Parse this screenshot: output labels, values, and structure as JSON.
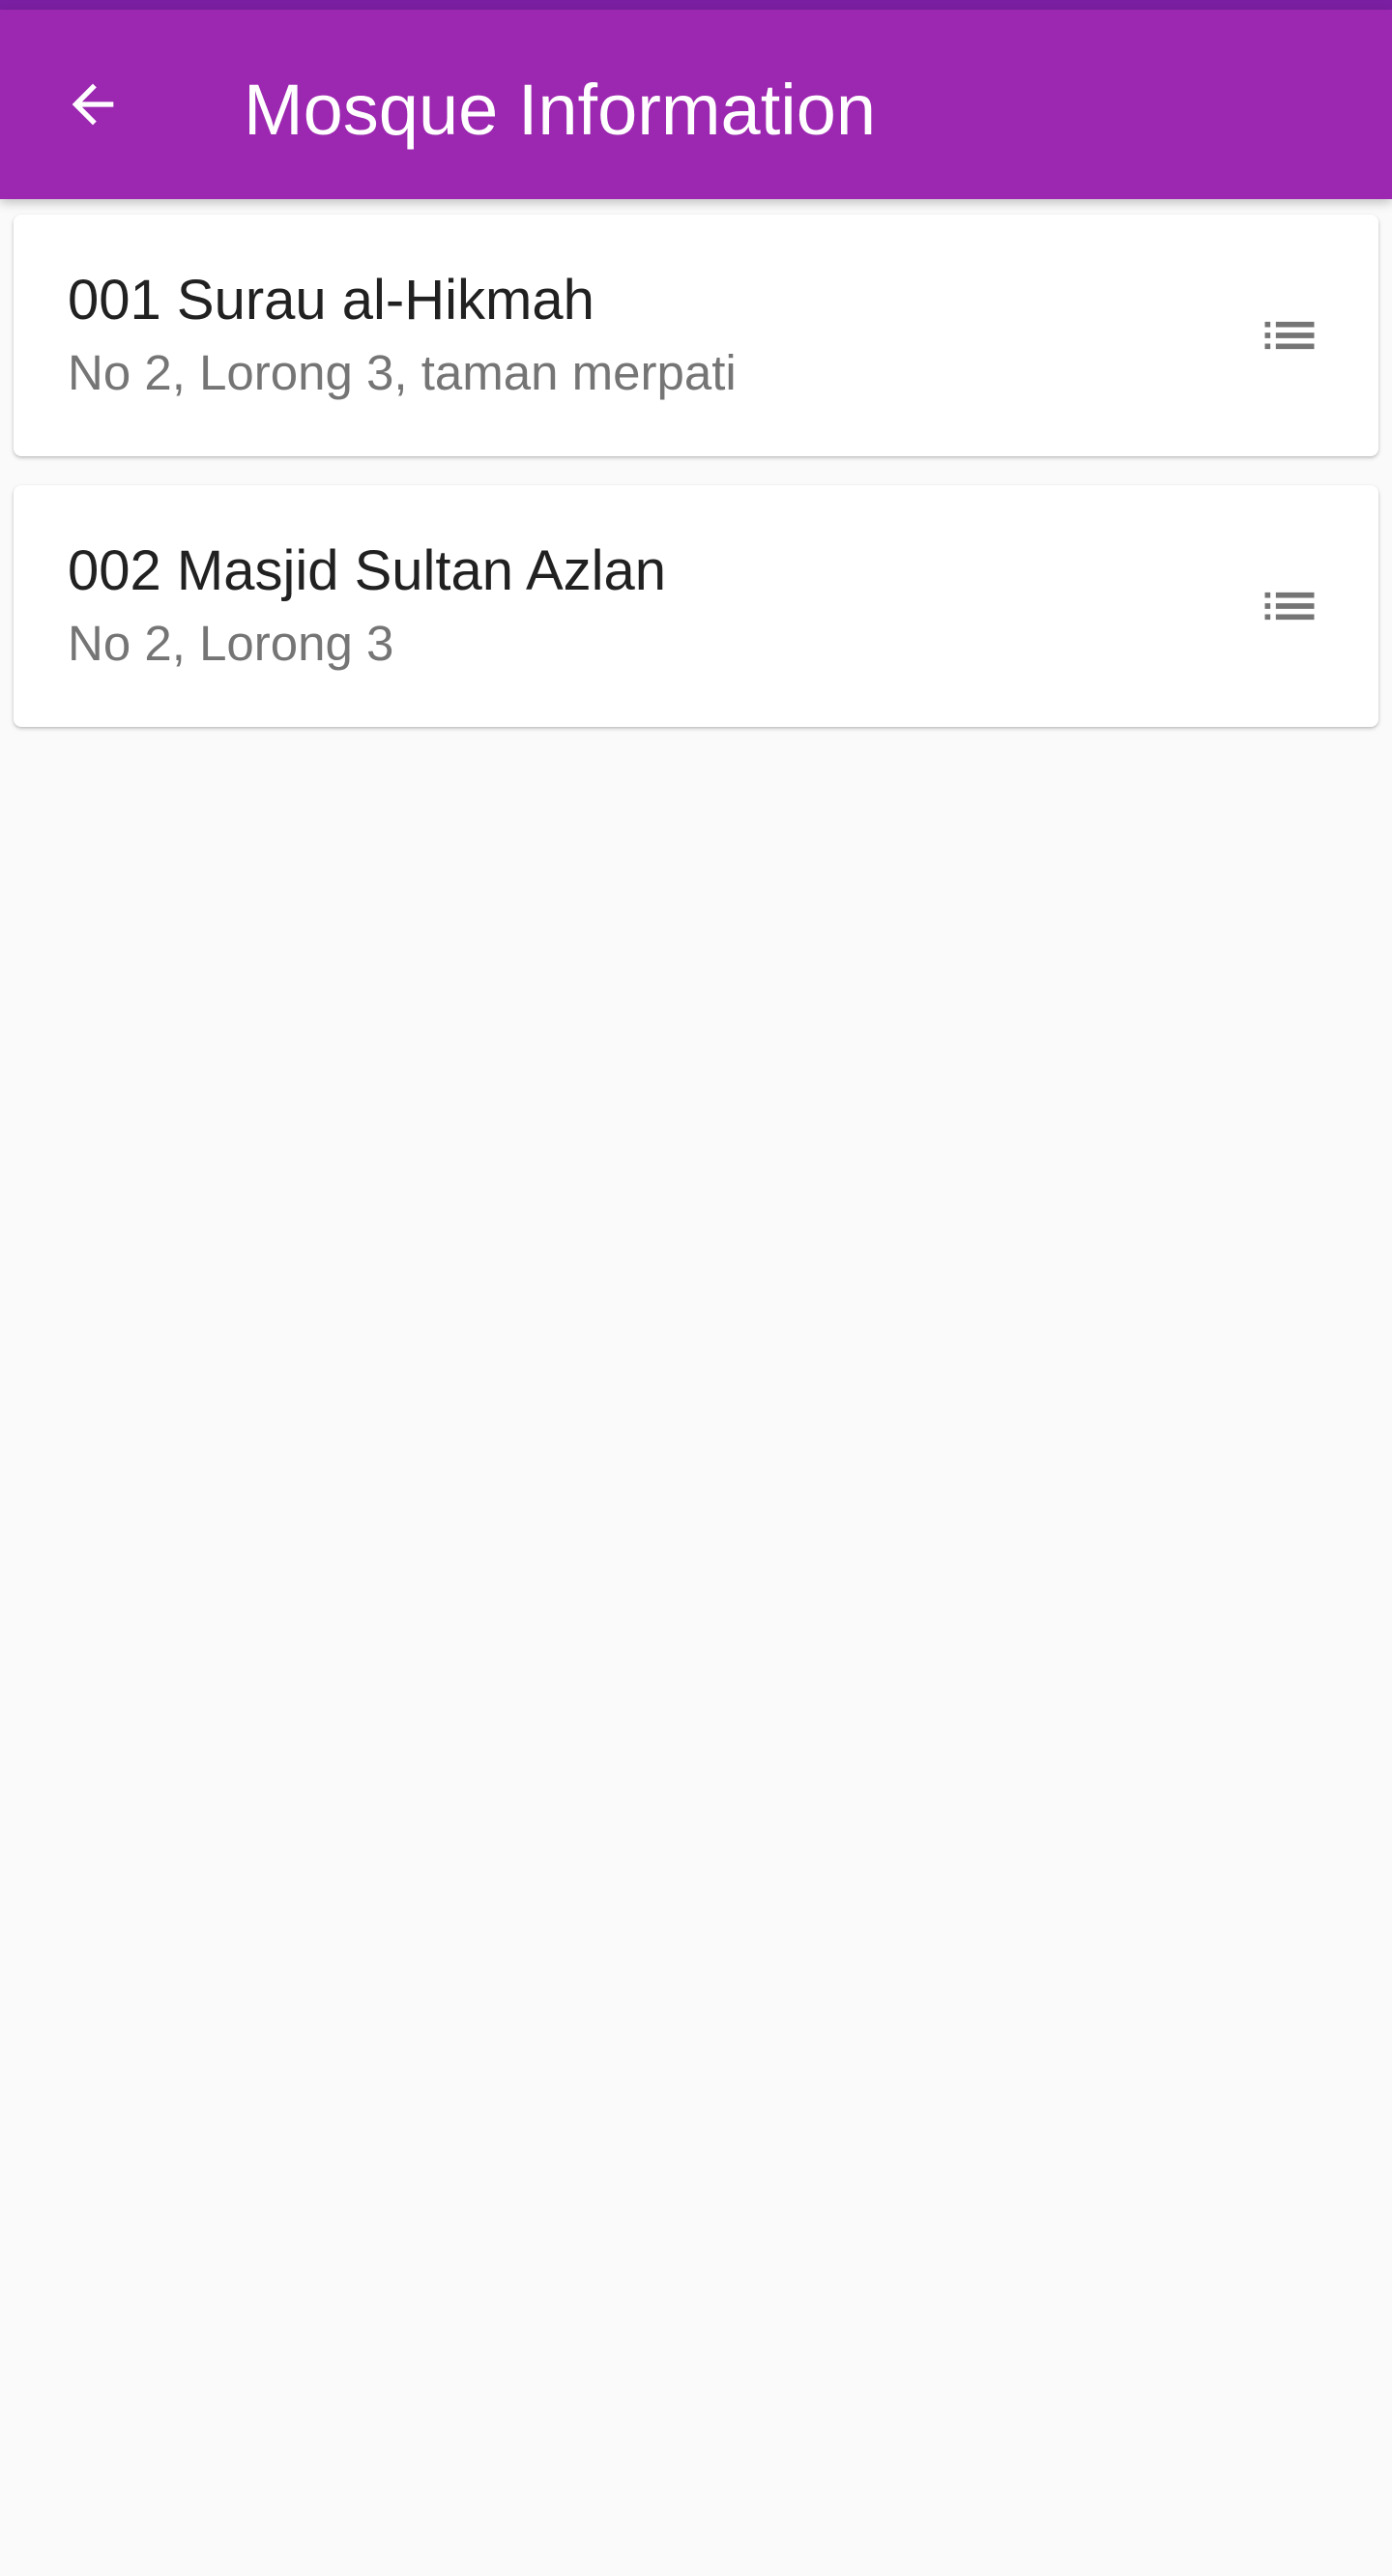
{
  "app_bar": {
    "title": "Mosque Information",
    "back_icon": "arrow-back-icon",
    "color": "#9c27b0",
    "status_color": "#7b1fa2"
  },
  "mosques": [
    {
      "title": "001 Surau al-Hikmah",
      "address": "No 2, Lorong 3, taman merpati",
      "icon": "list-icon"
    },
    {
      "title": "002 Masjid Sultan Azlan",
      "address": "No 2, Lorong 3",
      "icon": "list-icon"
    }
  ]
}
